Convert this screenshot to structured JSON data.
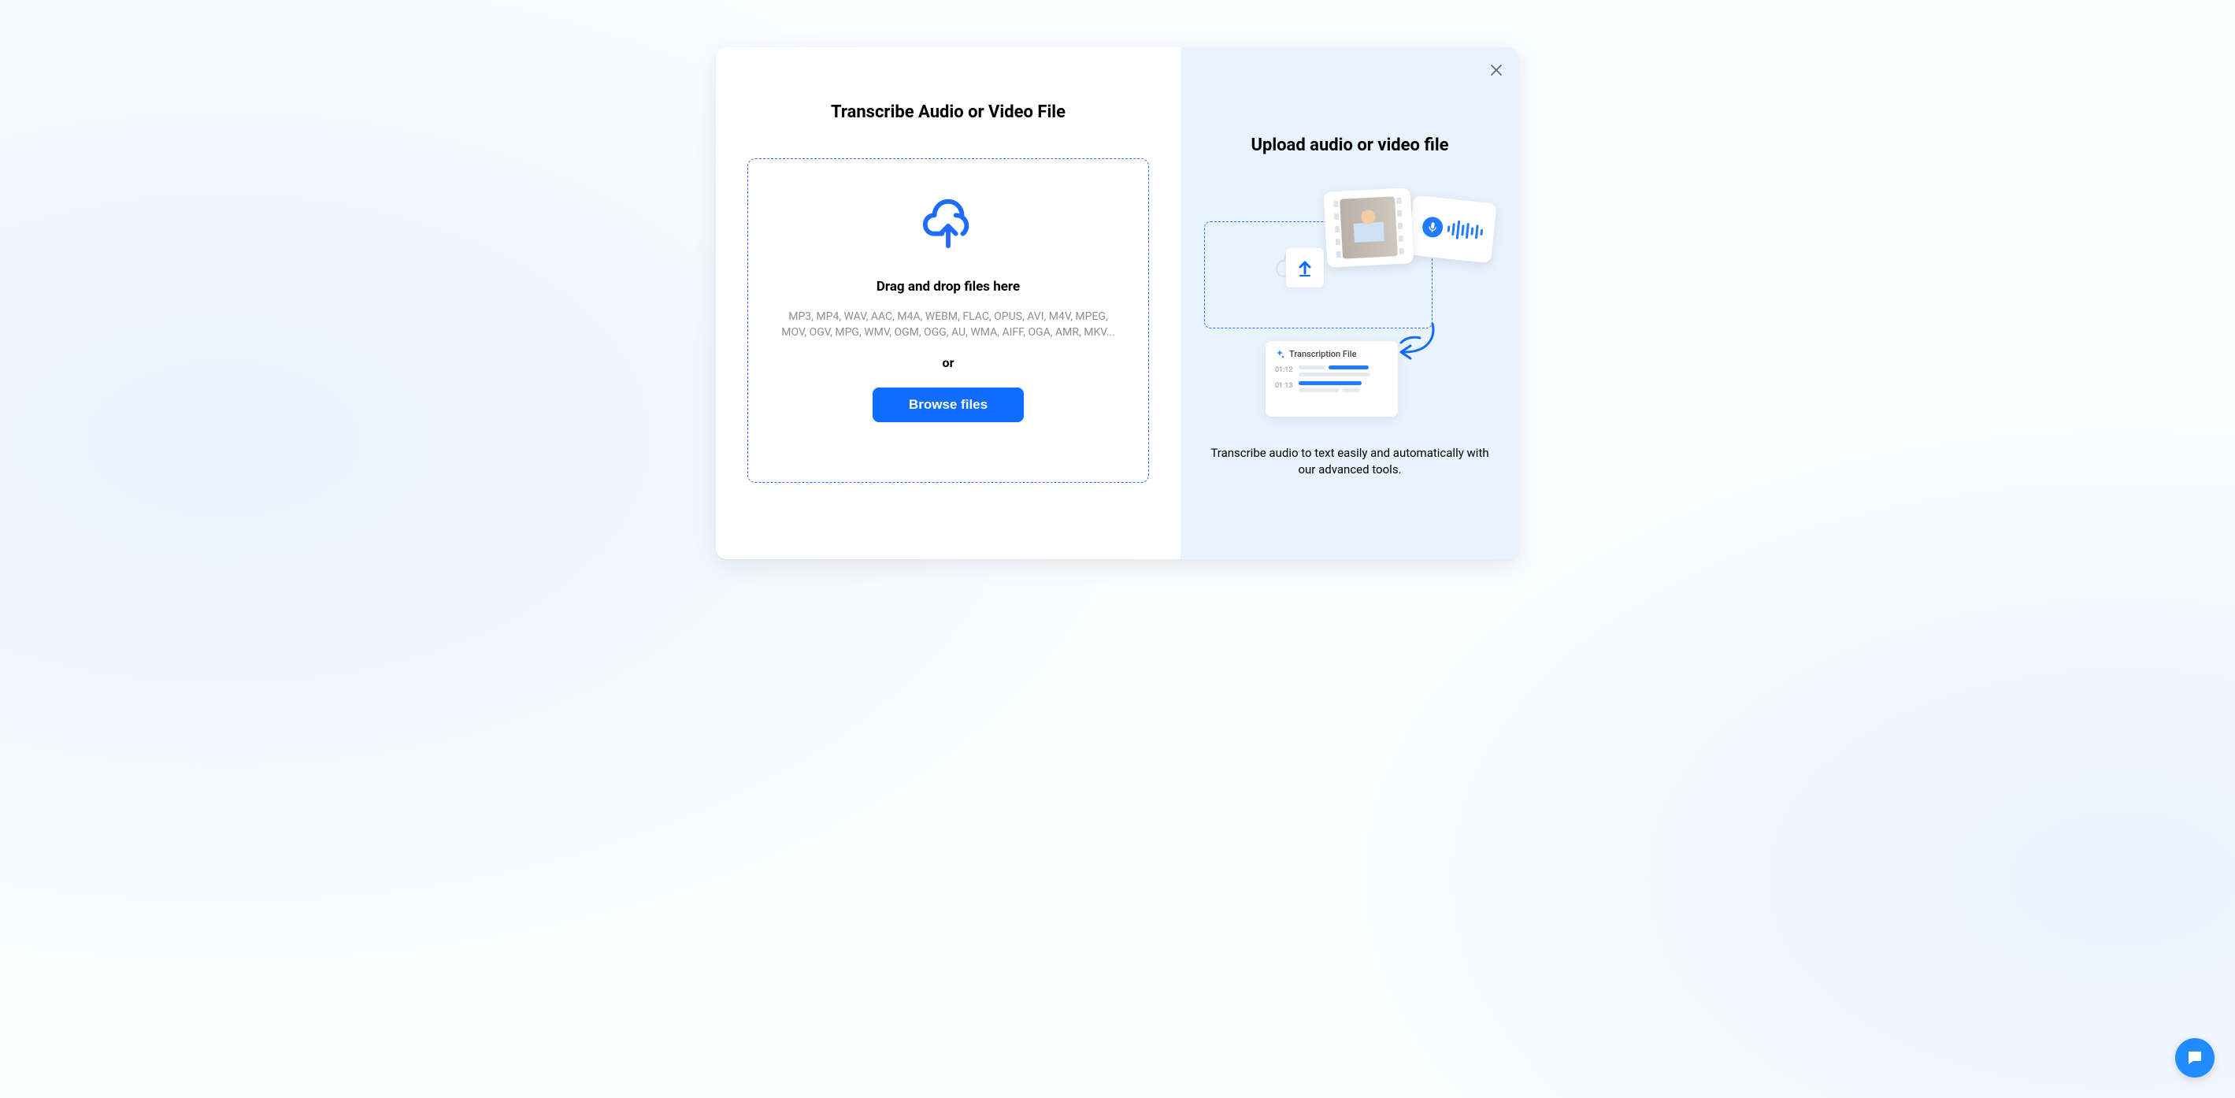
{
  "modal": {
    "left": {
      "title": "Transcribe Audio or Video File",
      "drop_title": "Drag and drop files here",
      "formats": "MP3, MP4, WAV, AAC, M4A, WEBM, FLAC, OPUS, AVI, M4V, MPEG, MOV, OGV, MPG, WMV, OGM, OGG, AU, WMA, AIFF, OGA, AMR, MKV...",
      "or": "or",
      "browse_label": "Browse files"
    },
    "right": {
      "title": "Upload audio or video file",
      "description": "Transcribe audio to text easily and automatically with our advanced tools.",
      "transcript_card": {
        "title": "Transcription File",
        "rows": [
          {
            "time": "01:12"
          },
          {
            "time": "01:13"
          }
        ]
      }
    }
  }
}
